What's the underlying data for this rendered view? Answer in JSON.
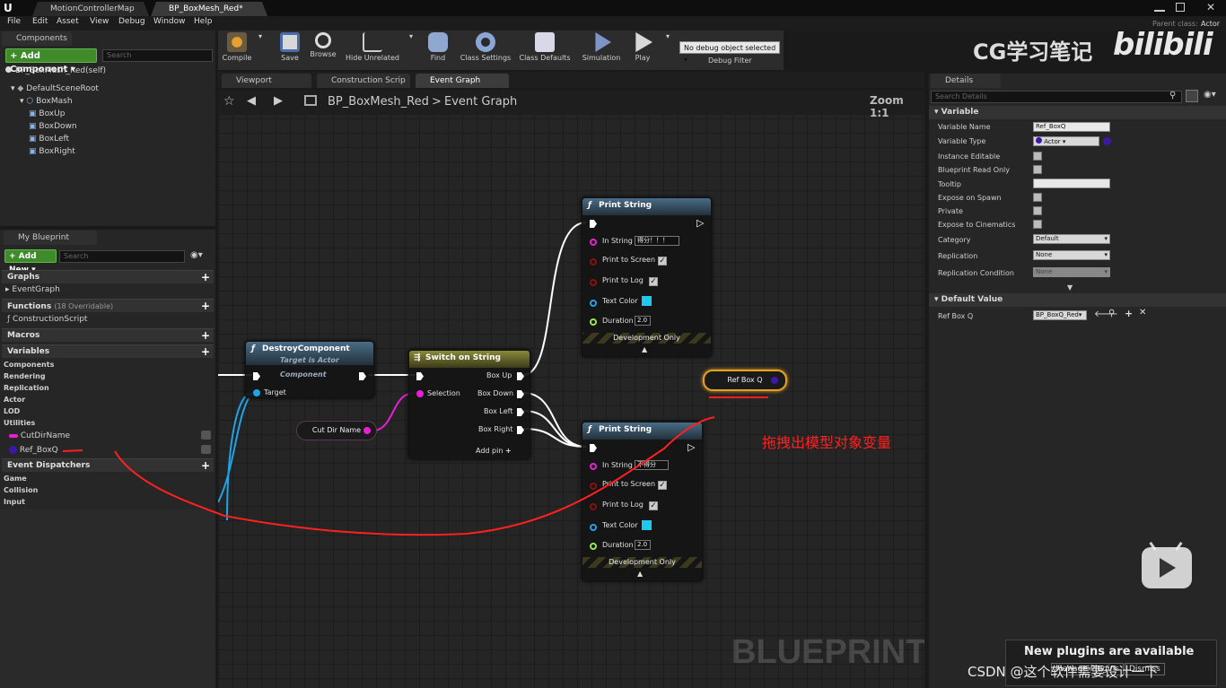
{
  "window": {
    "tabs": [
      "MotionControllerMap",
      "BP_BoxMesh_Red*"
    ],
    "parent_class_label": "Parent class:",
    "parent_class_value": "Actor"
  },
  "menu": [
    "File",
    "Edit",
    "Asset",
    "View",
    "Debug",
    "Window",
    "Help"
  ],
  "components": {
    "header": "Components",
    "add_button": "+ Add Component ▾",
    "search_placeholder": "Search",
    "self": "BP_BoxMesh_Red(self)",
    "tree": [
      "DefaultSceneRoot",
      "BoxMash",
      "BoxUp",
      "BoxDown",
      "BoxLeft",
      "BoxRight"
    ]
  },
  "my_blueprint": {
    "tab": "My Blueprint",
    "add_new": "+ Add New ▾",
    "search_placeholder": "Search",
    "graphs_label": "Graphs",
    "event_graph": "EventGraph",
    "functions_label": "Functions",
    "functions_count": "(18 Overridable)",
    "construction_script": "ConstructionScript",
    "macros_label": "Macros",
    "variables_label": "Variables",
    "variable_groups": [
      "Components",
      "Rendering",
      "Replication",
      "Actor",
      "LOD",
      "Utilities"
    ],
    "variables": [
      "CutDirName",
      "Ref_BoxQ"
    ],
    "event_dispatchers_label": "Event Dispatchers",
    "dispatcher_groups": [
      "Game",
      "Collision",
      "Input"
    ]
  },
  "toolbar": {
    "buttons": [
      "Compile",
      "Save",
      "Browse",
      "Hide Unrelated",
      "Find",
      "Class Settings",
      "Class Defaults",
      "Simulation",
      "Play"
    ],
    "debug_select": "No debug object selected ▾",
    "debug_filter": "Debug Filter"
  },
  "editor_tabs": [
    "Viewport",
    "Construction Scrip",
    "Event Graph"
  ],
  "graph": {
    "breadcrumb_root": "BP_BoxMesh_Red",
    "breadcrumb_sep": ">",
    "breadcrumb_leaf": "Event Graph",
    "zoom": "Zoom 1:1",
    "watermark": "BLUEPRINT"
  },
  "nodes": {
    "destroy": {
      "title": "DestroyComponent",
      "subtitle": "Target is Actor Component",
      "target": "Target"
    },
    "switch": {
      "title": "Switch on String",
      "selection": "Selection",
      "outputs": [
        "Box Up",
        "Box Down",
        "Box Left",
        "Box Right"
      ],
      "add_pin": "Add pin"
    },
    "cutdir": {
      "label": "Cut Dir Name"
    },
    "print1": {
      "title": "Print String",
      "in_string": "In String",
      "in_value": "得分！！！",
      "to_screen": "Print to Screen",
      "to_log": "Print to Log",
      "text_color": "Text Color",
      "duration": "Duration",
      "duration_value": "2.0",
      "dev_only": "Development Only"
    },
    "print2": {
      "title": "Print String",
      "in_string": "In String",
      "in_value": "不得分",
      "to_screen": "Print to Screen",
      "to_log": "Print to Log",
      "text_color": "Text Color",
      "duration": "Duration",
      "duration_value": "2.0",
      "dev_only": "Development Only"
    },
    "refbox": {
      "label": "Ref Box Q"
    }
  },
  "annotation": "拖拽出模型对象变量",
  "details": {
    "tab": "Details",
    "search_placeholder": "Search Details",
    "section_variable": "Variable",
    "rows": [
      {
        "label": "Variable Name",
        "value": "Ref_BoxQ"
      },
      {
        "label": "Variable Type",
        "value": "Actor"
      },
      {
        "label": "Instance Editable",
        "value": ""
      },
      {
        "label": "Blueprint Read Only",
        "value": ""
      },
      {
        "label": "Tooltip",
        "value": ""
      },
      {
        "label": "Expose on Spawn",
        "value": ""
      },
      {
        "label": "Private",
        "value": ""
      },
      {
        "label": "Expose to Cinematics",
        "value": ""
      },
      {
        "label": "Category",
        "value": "Default"
      },
      {
        "label": "Replication",
        "value": "None"
      },
      {
        "label": "Replication Condition",
        "value": "None"
      }
    ],
    "section_default": "Default Value",
    "default_label": "Ref Box Q",
    "default_value": "BP_BoxQ_Red"
  },
  "overlay": {
    "brand_text": "CG学习笔记",
    "brand_logo": "bilibili",
    "notification": "New plugins are available",
    "notification_action": "Manage Plugins",
    "notification_dismiss": "Dismiss",
    "csdn": "CSDN @这个软件需要设计一下"
  },
  "colors": {
    "exec_pin": "#ffffff",
    "object_pin": "#1fa3e8",
    "string_pin": "#e91fd3",
    "bool_pin": "#8b1010",
    "float_pin": "#9ce44b",
    "color_swatch": "#1ec8f0",
    "annotation_red": "#ff2020"
  }
}
